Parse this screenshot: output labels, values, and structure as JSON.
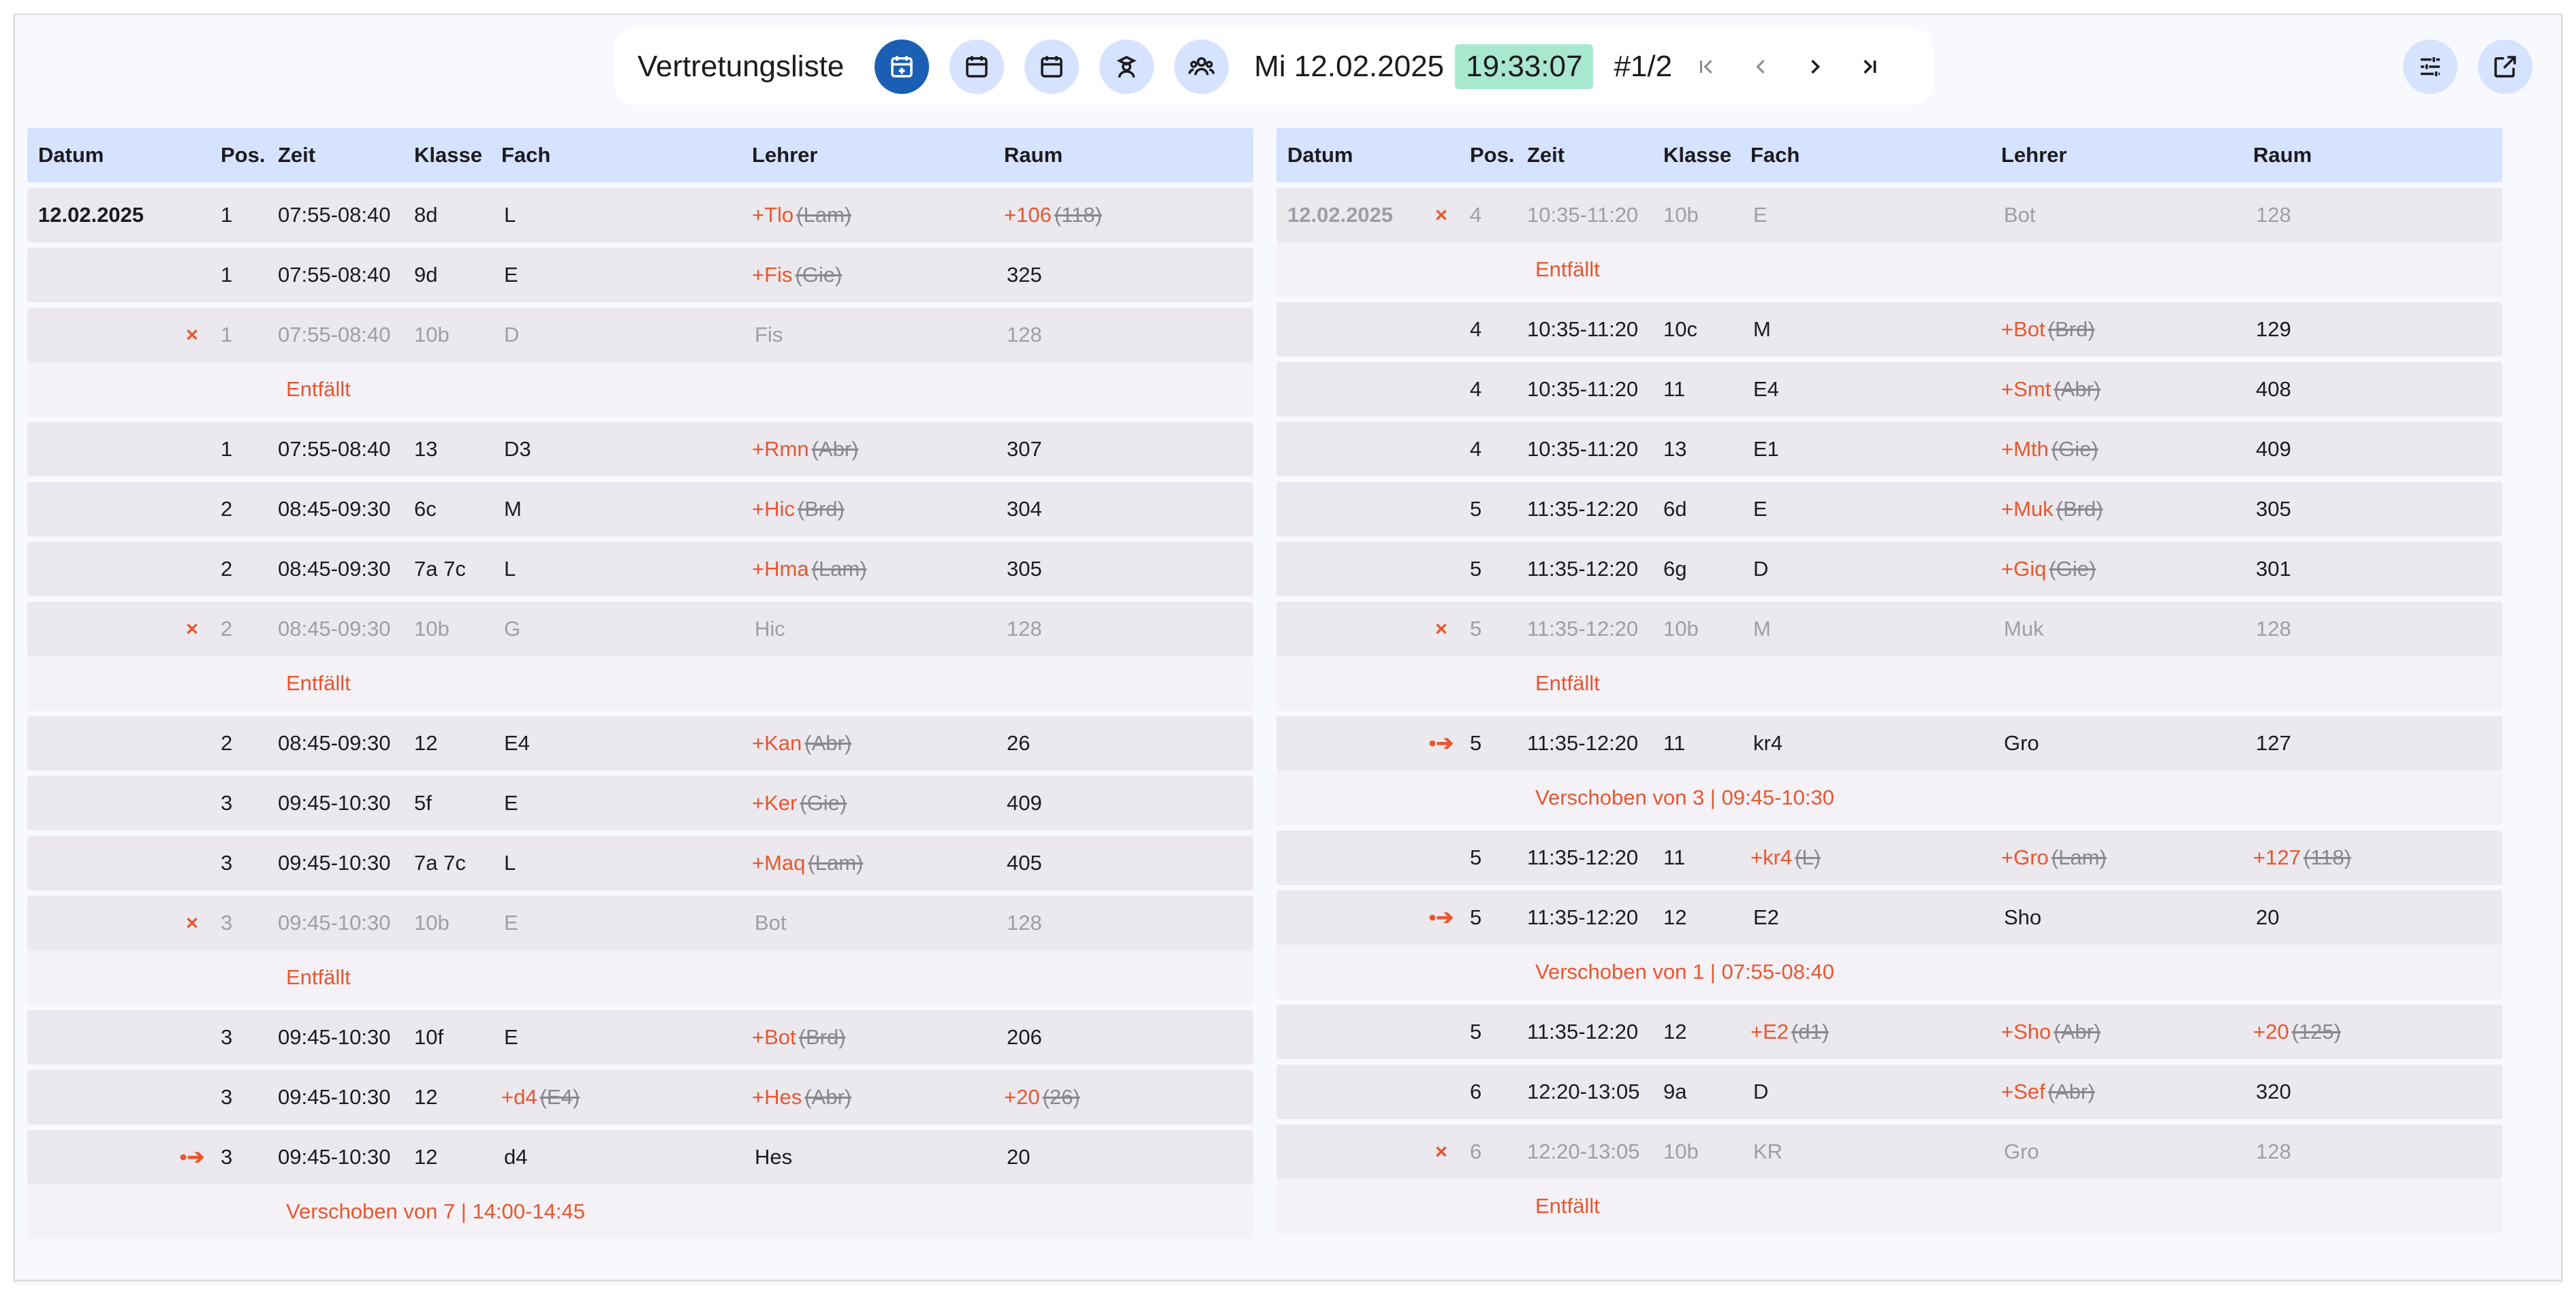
{
  "toolbar": {
    "title": "Vertretungsliste",
    "date": "Mi 12.02.2025",
    "time": "19:33:07",
    "page": "#1/2",
    "icons": [
      "calendar-add-icon",
      "calendar-icon",
      "calendar-icon",
      "teacher-icon",
      "group-icon"
    ],
    "nav": [
      "first-page-icon",
      "chevron-left-icon",
      "chevron-right-icon",
      "last-page-icon"
    ],
    "right_icons": [
      "tune-icon",
      "open-in-new-icon"
    ]
  },
  "colors": {
    "accent": "#1a5fb4",
    "icon_bg": "#d6e3ff",
    "change": "#e8572e",
    "time_badge": "#a8e8cf",
    "header_bg": "#d6e3ff"
  },
  "headers": [
    "Datum",
    "Pos.",
    "Zeit",
    "Klasse",
    "Fach",
    "Lehrer",
    "Raum"
  ],
  "left_rows": [
    {
      "date": "12.02.2025",
      "mark": "",
      "pos": "1",
      "time": "07:55-08:40",
      "klasse": "8d",
      "fach": {
        "sub": "",
        "old": "",
        "text": "L"
      },
      "lehrer": {
        "sub": "+Tlo",
        "old": "(Lam)",
        "text": ""
      },
      "raum": {
        "sub": "+106",
        "old": "(118)",
        "text": ""
      }
    },
    {
      "date": "",
      "mark": "",
      "pos": "1",
      "time": "07:55-08:40",
      "klasse": "9d",
      "fach": {
        "sub": "",
        "old": "",
        "text": "E"
      },
      "lehrer": {
        "sub": "+Fis",
        "old": "(Gie)",
        "text": ""
      },
      "raum": {
        "sub": "",
        "old": "",
        "text": "325"
      }
    },
    {
      "date": "",
      "mark": "×",
      "pos": "1",
      "time": "07:55-08:40",
      "klasse": "10b",
      "fach": {
        "sub": "",
        "old": "",
        "text": "D"
      },
      "lehrer": {
        "sub": "",
        "old": "",
        "text": "Fis"
      },
      "raum": {
        "sub": "",
        "old": "",
        "text": "128"
      },
      "muted": true
    },
    {
      "note": "Entfällt"
    },
    {
      "date": "",
      "mark": "",
      "pos": "1",
      "time": "07:55-08:40",
      "klasse": "13",
      "fach": {
        "sub": "",
        "old": "",
        "text": "D3"
      },
      "lehrer": {
        "sub": "+Rmn",
        "old": "(Abr)",
        "text": ""
      },
      "raum": {
        "sub": "",
        "old": "",
        "text": "307"
      }
    },
    {
      "date": "",
      "mark": "",
      "pos": "2",
      "time": "08:45-09:30",
      "klasse": "6c",
      "fach": {
        "sub": "",
        "old": "",
        "text": "M"
      },
      "lehrer": {
        "sub": "+Hic",
        "old": "(Brd)",
        "text": ""
      },
      "raum": {
        "sub": "",
        "old": "",
        "text": "304"
      }
    },
    {
      "date": "",
      "mark": "",
      "pos": "2",
      "time": "08:45-09:30",
      "klasse": "7a 7c",
      "fach": {
        "sub": "",
        "old": "",
        "text": "L"
      },
      "lehrer": {
        "sub": "+Hma",
        "old": "(Lam)",
        "text": ""
      },
      "raum": {
        "sub": "",
        "old": "",
        "text": "305"
      }
    },
    {
      "date": "",
      "mark": "×",
      "pos": "2",
      "time": "08:45-09:30",
      "klasse": "10b",
      "fach": {
        "sub": "",
        "old": "",
        "text": "G"
      },
      "lehrer": {
        "sub": "",
        "old": "",
        "text": "Hic"
      },
      "raum": {
        "sub": "",
        "old": "",
        "text": "128"
      },
      "muted": true
    },
    {
      "note": "Entfällt"
    },
    {
      "date": "",
      "mark": "",
      "pos": "2",
      "time": "08:45-09:30",
      "klasse": "12",
      "fach": {
        "sub": "",
        "old": "",
        "text": "E4"
      },
      "lehrer": {
        "sub": "+Kan",
        "old": "(Abr)",
        "text": ""
      },
      "raum": {
        "sub": "",
        "old": "",
        "text": "26"
      }
    },
    {
      "date": "",
      "mark": "",
      "pos": "3",
      "time": "09:45-10:30",
      "klasse": "5f",
      "fach": {
        "sub": "",
        "old": "",
        "text": "E"
      },
      "lehrer": {
        "sub": "+Ker",
        "old": "(Gie)",
        "text": ""
      },
      "raum": {
        "sub": "",
        "old": "",
        "text": "409"
      }
    },
    {
      "date": "",
      "mark": "",
      "pos": "3",
      "time": "09:45-10:30",
      "klasse": "7a 7c",
      "fach": {
        "sub": "",
        "old": "",
        "text": "L"
      },
      "lehrer": {
        "sub": "+Maq",
        "old": "(Lam)",
        "text": ""
      },
      "raum": {
        "sub": "",
        "old": "",
        "text": "405"
      }
    },
    {
      "date": "",
      "mark": "×",
      "pos": "3",
      "time": "09:45-10:30",
      "klasse": "10b",
      "fach": {
        "sub": "",
        "old": "",
        "text": "E"
      },
      "lehrer": {
        "sub": "",
        "old": "",
        "text": "Bot"
      },
      "raum": {
        "sub": "",
        "old": "",
        "text": "128"
      },
      "muted": true
    },
    {
      "note": "Entfällt"
    },
    {
      "date": "",
      "mark": "",
      "pos": "3",
      "time": "09:45-10:30",
      "klasse": "10f",
      "fach": {
        "sub": "",
        "old": "",
        "text": "E"
      },
      "lehrer": {
        "sub": "+Bot",
        "old": "(Brd)",
        "text": ""
      },
      "raum": {
        "sub": "",
        "old": "",
        "text": "206"
      }
    },
    {
      "date": "",
      "mark": "",
      "pos": "3",
      "time": "09:45-10:30",
      "klasse": "12",
      "fach": {
        "sub": "+d4",
        "old": "(E4)",
        "text": ""
      },
      "lehrer": {
        "sub": "+Hes",
        "old": "(Abr)",
        "text": ""
      },
      "raum": {
        "sub": "+20",
        "old": "(26)",
        "text": ""
      }
    },
    {
      "date": "",
      "mark": "•➔",
      "pos": "3",
      "time": "09:45-10:30",
      "klasse": "12",
      "fach": {
        "sub": "",
        "old": "",
        "text": "d4"
      },
      "lehrer": {
        "sub": "",
        "old": "",
        "text": "Hes"
      },
      "raum": {
        "sub": "",
        "old": "",
        "text": "20"
      }
    },
    {
      "note": "Verschoben von 7 | 14:00-14:45"
    }
  ],
  "right_rows": [
    {
      "date": "12.02.2025",
      "mark": "×",
      "pos": "4",
      "time": "10:35-11:20",
      "klasse": "10b",
      "fach": {
        "sub": "",
        "old": "",
        "text": "E"
      },
      "lehrer": {
        "sub": "",
        "old": "",
        "text": "Bot"
      },
      "raum": {
        "sub": "",
        "old": "",
        "text": "128"
      },
      "muted": true
    },
    {
      "note": "Entfällt"
    },
    {
      "date": "",
      "mark": "",
      "pos": "4",
      "time": "10:35-11:20",
      "klasse": "10c",
      "fach": {
        "sub": "",
        "old": "",
        "text": "M"
      },
      "lehrer": {
        "sub": "+Bot",
        "old": "(Brd)",
        "text": ""
      },
      "raum": {
        "sub": "",
        "old": "",
        "text": "129"
      }
    },
    {
      "date": "",
      "mark": "",
      "pos": "4",
      "time": "10:35-11:20",
      "klasse": "11",
      "fach": {
        "sub": "",
        "old": "",
        "text": "E4"
      },
      "lehrer": {
        "sub": "+Smt",
        "old": "(Abr)",
        "text": ""
      },
      "raum": {
        "sub": "",
        "old": "",
        "text": "408"
      }
    },
    {
      "date": "",
      "mark": "",
      "pos": "4",
      "time": "10:35-11:20",
      "klasse": "13",
      "fach": {
        "sub": "",
        "old": "",
        "text": "E1"
      },
      "lehrer": {
        "sub": "+Mth",
        "old": "(Gie)",
        "text": ""
      },
      "raum": {
        "sub": "",
        "old": "",
        "text": "409"
      }
    },
    {
      "date": "",
      "mark": "",
      "pos": "5",
      "time": "11:35-12:20",
      "klasse": "6d",
      "fach": {
        "sub": "",
        "old": "",
        "text": "E"
      },
      "lehrer": {
        "sub": "+Muk",
        "old": "(Brd)",
        "text": ""
      },
      "raum": {
        "sub": "",
        "old": "",
        "text": "305"
      }
    },
    {
      "date": "",
      "mark": "",
      "pos": "5",
      "time": "11:35-12:20",
      "klasse": "6g",
      "fach": {
        "sub": "",
        "old": "",
        "text": "D"
      },
      "lehrer": {
        "sub": "+Giq",
        "old": "(Gie)",
        "text": ""
      },
      "raum": {
        "sub": "",
        "old": "",
        "text": "301"
      }
    },
    {
      "date": "",
      "mark": "×",
      "pos": "5",
      "time": "11:35-12:20",
      "klasse": "10b",
      "fach": {
        "sub": "",
        "old": "",
        "text": "M"
      },
      "lehrer": {
        "sub": "",
        "old": "",
        "text": "Muk"
      },
      "raum": {
        "sub": "",
        "old": "",
        "text": "128"
      },
      "muted": true
    },
    {
      "note": "Entfällt"
    },
    {
      "date": "",
      "mark": "•➔",
      "pos": "5",
      "time": "11:35-12:20",
      "klasse": "11",
      "fach": {
        "sub": "",
        "old": "",
        "text": "kr4"
      },
      "lehrer": {
        "sub": "",
        "old": "",
        "text": "Gro"
      },
      "raum": {
        "sub": "",
        "old": "",
        "text": "127"
      }
    },
    {
      "note": "Verschoben von 3 | 09:45-10:30"
    },
    {
      "date": "",
      "mark": "",
      "pos": "5",
      "time": "11:35-12:20",
      "klasse": "11",
      "fach": {
        "sub": "+kr4",
        "old": "(L)",
        "text": ""
      },
      "lehrer": {
        "sub": "+Gro",
        "old": "(Lam)",
        "text": ""
      },
      "raum": {
        "sub": "+127",
        "old": "(118)",
        "text": ""
      }
    },
    {
      "date": "",
      "mark": "•➔",
      "pos": "5",
      "time": "11:35-12:20",
      "klasse": "12",
      "fach": {
        "sub": "",
        "old": "",
        "text": "E2"
      },
      "lehrer": {
        "sub": "",
        "old": "",
        "text": "Sho"
      },
      "raum": {
        "sub": "",
        "old": "",
        "text": "20"
      }
    },
    {
      "note": "Verschoben von 1 | 07:55-08:40"
    },
    {
      "date": "",
      "mark": "",
      "pos": "5",
      "time": "11:35-12:20",
      "klasse": "12",
      "fach": {
        "sub": "+E2",
        "old": "(d1)",
        "text": ""
      },
      "lehrer": {
        "sub": "+Sho",
        "old": "(Abr)",
        "text": ""
      },
      "raum": {
        "sub": "+20",
        "old": "(125)",
        "text": ""
      }
    },
    {
      "date": "",
      "mark": "",
      "pos": "6",
      "time": "12:20-13:05",
      "klasse": "9a",
      "fach": {
        "sub": "",
        "old": "",
        "text": "D"
      },
      "lehrer": {
        "sub": "+Sef",
        "old": "(Abr)",
        "text": ""
      },
      "raum": {
        "sub": "",
        "old": "",
        "text": "320"
      }
    },
    {
      "date": "",
      "mark": "×",
      "pos": "6",
      "time": "12:20-13:05",
      "klasse": "10b",
      "fach": {
        "sub": "",
        "old": "",
        "text": "KR"
      },
      "lehrer": {
        "sub": "",
        "old": "",
        "text": "Gro"
      },
      "raum": {
        "sub": "",
        "old": "",
        "text": "128"
      },
      "muted": true
    },
    {
      "note": "Entfällt"
    }
  ]
}
